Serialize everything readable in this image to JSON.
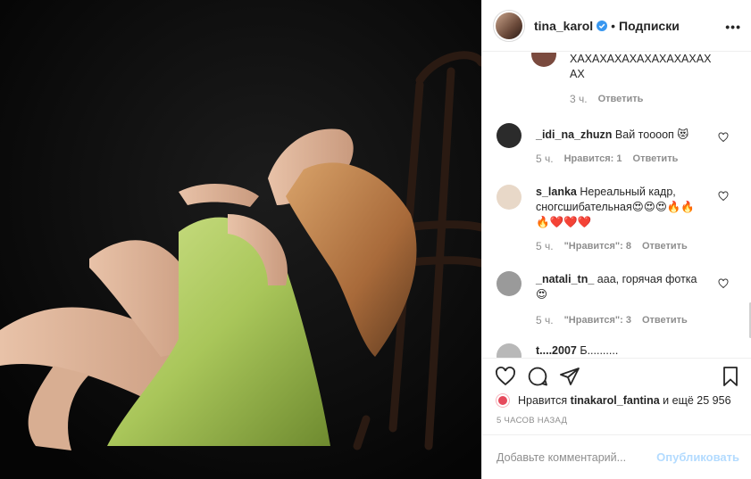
{
  "header": {
    "username": "tina_karol",
    "separator": "•",
    "follow_state": "Подписки",
    "more": "•••"
  },
  "comments": [
    {
      "username": "",
      "text": "ХАХАХАХАХАХАХАХАХАХ",
      "text_line2": "АХ",
      "time": "3 ч.",
      "likes": "",
      "reply": "Ответить"
    },
    {
      "username": "_idi_na_zhuzn",
      "text": "Вай тооооп 😻",
      "time": "5 ч.",
      "likes": "Нравится: 1",
      "reply": "Ответить"
    },
    {
      "username": "s_lanka",
      "text": "Нереальный кадр,",
      "text_line2": "сногсшибательная😍😍😍🔥🔥",
      "text_line3": "🔥❤️❤️❤️",
      "time": "5 ч.",
      "likes": "\"Нравится\": 8",
      "reply": "Ответить"
    },
    {
      "username": "_natali_tn_",
      "text": "ааа, горячая фотка",
      "text_line2": "😍",
      "time": "5 ч.",
      "likes": "\"Нравится\": 3",
      "reply": "Ответить"
    },
    {
      "username": "t....2007",
      "text": "Б..........",
      "time": "",
      "likes": "",
      "reply": ""
    }
  ],
  "likes": {
    "prefix": "Нравится",
    "user": "tinakarol_fantina",
    "suffix": "и ещё 25 956"
  },
  "timestamp": "5 ЧАСОВ НАЗАД",
  "comment_box": {
    "placeholder": "Добавьте комментарий...",
    "publish": "Опубликовать"
  },
  "colors": {
    "verified": "#3897f0",
    "muted": "#8e8e8e",
    "publish_disabled": "#b3dbff",
    "dress": "#a9c65a"
  },
  "icons": [
    "more-icon",
    "verified-icon",
    "heart-icon",
    "comment-icon",
    "share-icon",
    "bookmark-icon",
    "small-heart-icon"
  ]
}
